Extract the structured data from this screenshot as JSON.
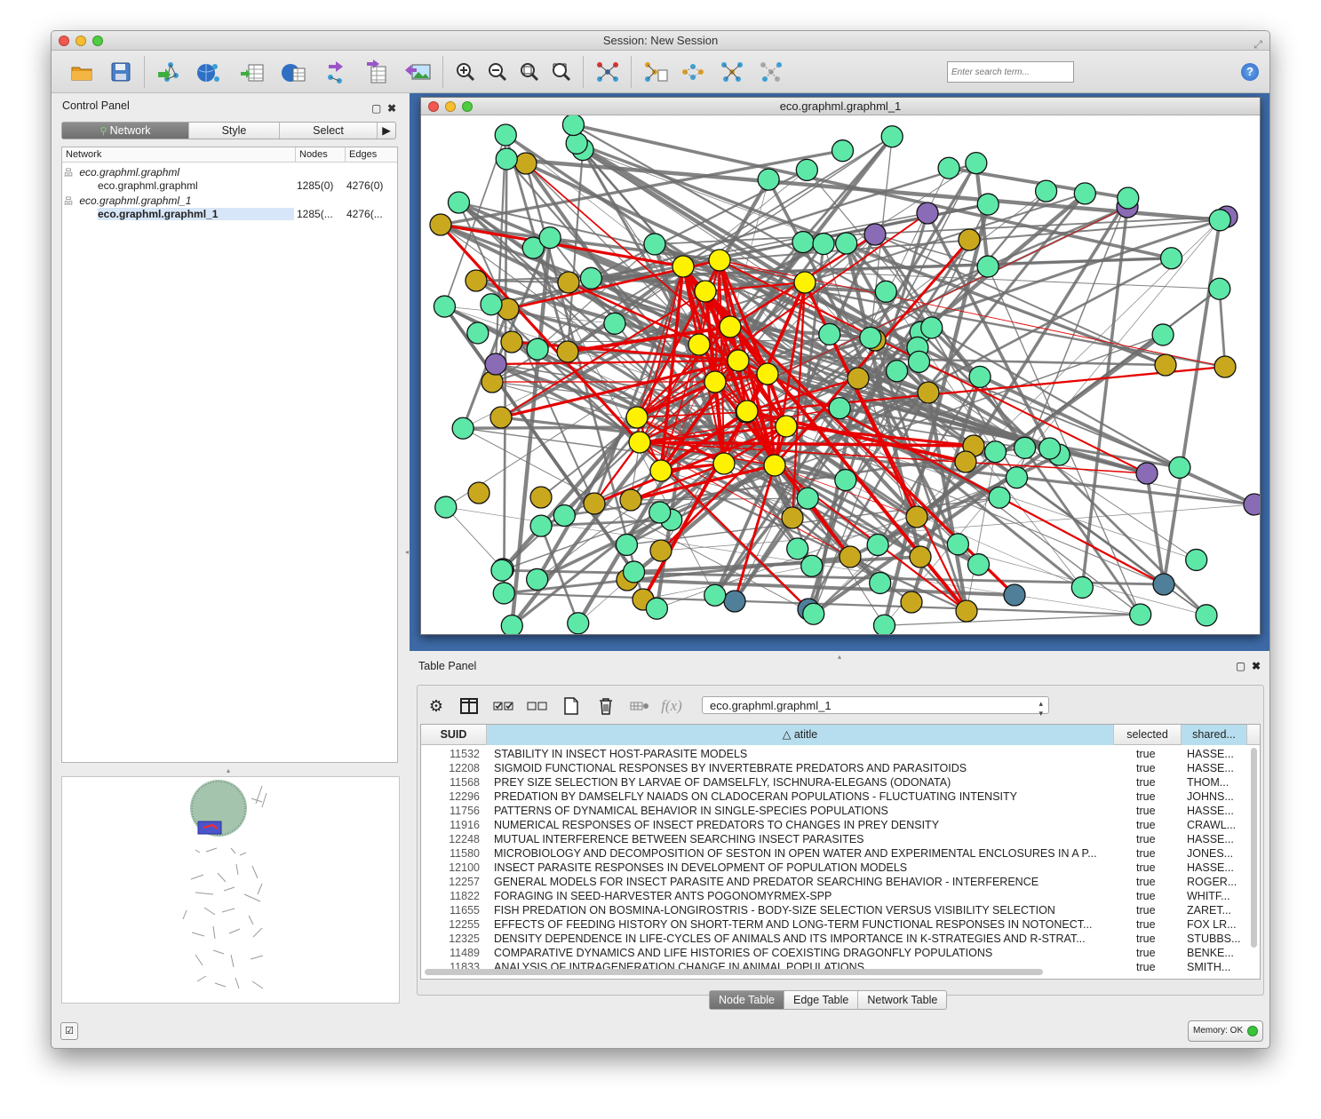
{
  "window": {
    "title": "Session: New Session"
  },
  "toolbar": {
    "search_placeholder": "Enter search term...",
    "help_label": "?"
  },
  "control_panel": {
    "title": "Control Panel",
    "tabs": [
      "Network",
      "Style",
      "Select"
    ],
    "columns": {
      "network": "Network",
      "nodes": "Nodes",
      "edges": "Edges"
    },
    "collections": [
      {
        "name": "eco.graphml.graphml",
        "network": "eco.graphml.graphml",
        "nodes": "1285(0)",
        "edges": "4276(0)"
      },
      {
        "name": "eco.graphml.graphml_1",
        "network": "eco.graphml.graphml_1",
        "nodes": "1285(...",
        "edges": "4276(..."
      }
    ]
  },
  "network_view": {
    "title": "eco.graphml.graphml_1"
  },
  "table_panel": {
    "title": "Table Panel",
    "selected_table": "eco.graphml.graphml_1",
    "columns": {
      "suid": "SUID",
      "atitle": "atitle",
      "selected": "selected",
      "shared": "shared..."
    },
    "rows": [
      {
        "suid": "11532",
        "atitle": "STABILITY IN INSECT HOST-PARASITE MODELS",
        "selected": "true",
        "shared": "HASSE..."
      },
      {
        "suid": "12208",
        "atitle": "SIGMOID FUNCTIONAL RESPONSES BY INVERTEBRATE PREDATORS AND PARASITOIDS",
        "selected": "true",
        "shared": "HASSE..."
      },
      {
        "suid": "11568",
        "atitle": "PREY SIZE SELECTION BY LARVAE OF DAMSELFLY, ISCHNURA-ELEGANS (ODONATA)",
        "selected": "true",
        "shared": "THOM..."
      },
      {
        "suid": "12296",
        "atitle": "PREDATION BY DAMSELFLY NAIADS ON CLADOCERAN POPULATIONS - FLUCTUATING INTENSITY",
        "selected": "true",
        "shared": "JOHNS..."
      },
      {
        "suid": "11756",
        "atitle": "PATTERNS OF DYNAMICAL BEHAVIOR IN SINGLE-SPECIES POPULATIONS",
        "selected": "true",
        "shared": "HASSE..."
      },
      {
        "suid": "11916",
        "atitle": "NUMERICAL RESPONSES OF INSECT PREDATORS TO CHANGES IN PREY DENSITY",
        "selected": "true",
        "shared": "CRAWL..."
      },
      {
        "suid": "12248",
        "atitle": "MUTUAL INTERFERENCE BETWEEN SEARCHING INSECT PARASITES",
        "selected": "true",
        "shared": "HASSE..."
      },
      {
        "suid": "11580",
        "atitle": "MICROBIOLOGY AND DECOMPOSITION OF SESTON IN OPEN WATER AND EXPERIMENTAL ENCLOSURES IN A P...",
        "selected": "true",
        "shared": "JONES..."
      },
      {
        "suid": "12100",
        "atitle": "INSECT PARASITE RESPONSES IN DEVELOPMENT OF POPULATION MODELS",
        "selected": "true",
        "shared": "HASSE..."
      },
      {
        "suid": "12257",
        "atitle": "GENERAL MODELS FOR INSECT PARASITE AND PREDATOR SEARCHING BEHAVIOR - INTERFERENCE",
        "selected": "true",
        "shared": "ROGER..."
      },
      {
        "suid": "11822",
        "atitle": "FORAGING IN SEED-HARVESTER ANTS POGONOMYRMEX-SPP",
        "selected": "true",
        "shared": "WHITF..."
      },
      {
        "suid": "11655",
        "atitle": "FISH PREDATION ON BOSMINA-LONGIROSTRIS - BODY-SIZE SELECTION VERSUS VISIBILITY SELECTION",
        "selected": "true",
        "shared": "ZARET..."
      },
      {
        "suid": "12255",
        "atitle": "EFFECTS OF FEEDING HISTORY ON SHORT-TERM AND LONG-TERM FUNCTIONAL RESPONSES IN NOTONECT...",
        "selected": "true",
        "shared": "FOX LR..."
      },
      {
        "suid": "12325",
        "atitle": "DENSITY DEPENDENCE IN LIFE-CYCLES OF ANIMALS AND ITS IMPORTANCE IN K-STRATEGIES AND R-STRAT...",
        "selected": "true",
        "shared": "STUBBS..."
      },
      {
        "suid": "11489",
        "atitle": "COMPARATIVE DYNAMICS AND LIFE HISTORIES OF COEXISTING DRAGONFLY POPULATIONS",
        "selected": "true",
        "shared": "BENKE..."
      },
      {
        "suid": "11833",
        "atitle": "ANALYSIS OF INTRAGENERATION CHANGE IN ANIMAL POPULATIONS",
        "selected": "true",
        "shared": "SMITH..."
      }
    ],
    "bottom_tabs": [
      "Node Table",
      "Edge Table",
      "Network Table"
    ]
  },
  "status": {
    "memory": "Memory: OK"
  },
  "colors": {
    "node_teal": "#5de8a8",
    "node_gold": "#c9a81e",
    "node_yellow": "#fff200",
    "node_purple": "#8a6bb5",
    "node_slate": "#4f7f99",
    "edge_gray": "#6e6e6e",
    "edge_red": "#e60000",
    "selection_blue": "#3d6aa7"
  }
}
